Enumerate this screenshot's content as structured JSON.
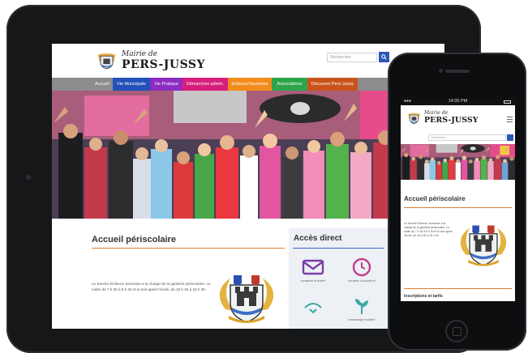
{
  "site": {
    "title_script": "Mairie de",
    "title_name": "PERS-JUSSY"
  },
  "search": {
    "placeholder": "Rechercher"
  },
  "nav": {
    "items": [
      {
        "label": "Accueil",
        "color": "#8d8d8d"
      },
      {
        "label": "Vie Municipale",
        "color": "#2450b9"
      },
      {
        "label": "Vie Pratique",
        "color": "#8c2cc0"
      },
      {
        "label": "Démarches admin.",
        "color": "#d61f7d"
      },
      {
        "label": "Enfance/Jeunesse",
        "color": "#f28c1c"
      },
      {
        "label": "Associations",
        "color": "#2ea44a"
      },
      {
        "label": "Découvrir Pers-Jussy",
        "color": "#c9531a"
      }
    ]
  },
  "main": {
    "section_title": "Accueil périscolaire",
    "paragraph": "Le Service Enfance Jeunesse a la charge de la garderie périscolaire. Le matin de 7 h 30 à 8 h 30 et le soir après l'école, de 16 h 30 à 18 h 30."
  },
  "aside": {
    "title": "Accès direct",
    "tiles": [
      {
        "label": "contacter la mairie",
        "icon": "envelope-icon",
        "color": "#7a3da6"
      },
      {
        "label": "horaires d'ouverture",
        "icon": "clock-icon",
        "color": "#c03b8f"
      },
      {
        "label": "",
        "icon": "water-icon",
        "color": "#3ea7a3"
      },
      {
        "label": "ramassage scolaire",
        "icon": "plant-icon",
        "color": "#3ea7a3"
      }
    ]
  },
  "phone": {
    "status_time": "14:05 PM",
    "carrier": "●●●",
    "search_placeholder": "Rechercher",
    "section_title": "Accueil périscolaire",
    "paragraph": "Le Service Enfance Jeunesse a la charge de la garderie périscolaire. Le matin de 7 h 30 à 8 h 30 et le soir après l'école, de 16 h 30 à 18 h 30.",
    "bottom_section": "Inscriptions et tarifs"
  },
  "colors": {
    "accent_orange": "#e07d2f",
    "accent_blue": "#3565c3",
    "search_button": "#2b57b9",
    "device_frame": "#161718"
  }
}
